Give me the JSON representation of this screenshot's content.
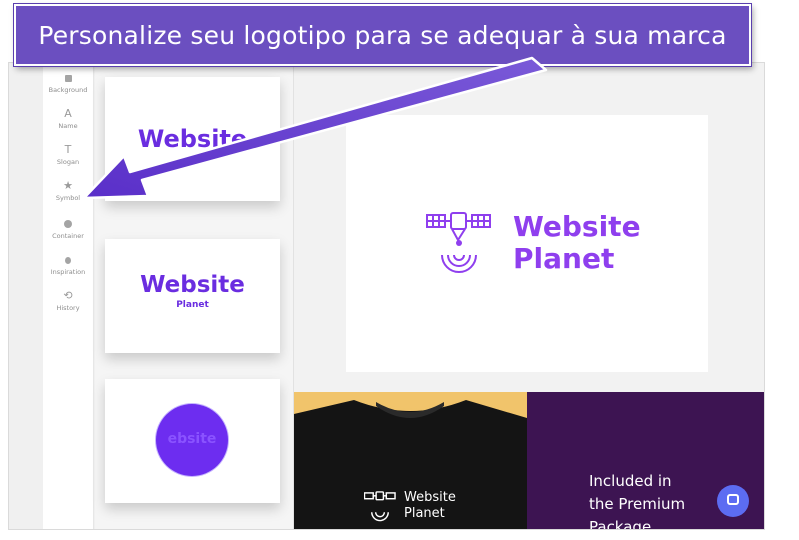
{
  "banner": {
    "text": "Personalize seu logotipo para se adequar à sua marca"
  },
  "sidebar": {
    "items": [
      {
        "label": "Background",
        "icon": "background-icon"
      },
      {
        "label": "Name",
        "icon": "name-icon"
      },
      {
        "label": "Slogan",
        "icon": "slogan-icon"
      },
      {
        "label": "Symbol",
        "icon": "star-icon"
      },
      {
        "label": "Container",
        "icon": "circle-icon"
      },
      {
        "label": "Inspiration",
        "icon": "bulb-icon"
      },
      {
        "label": "History",
        "icon": "history-icon"
      }
    ]
  },
  "variants": [
    {
      "name": "Website"
    },
    {
      "name": "Website",
      "slogan": "Planet"
    },
    {
      "name": "ebsite"
    }
  ],
  "preview": {
    "line1": "Website",
    "line2": "Planet"
  },
  "tshirt": {
    "line1": "Website",
    "line2": "Planet"
  },
  "promo": {
    "line1": "Included in",
    "line2": "the Premium",
    "line3": "Package"
  },
  "colors": {
    "banner": "#6b4fc0",
    "brand_purple": "#6a2de0",
    "logo_purple": "#8f3fee",
    "promo_bg": "#3d1452",
    "tee_bg": "#f1c46b",
    "chat": "#5c6cf2"
  }
}
